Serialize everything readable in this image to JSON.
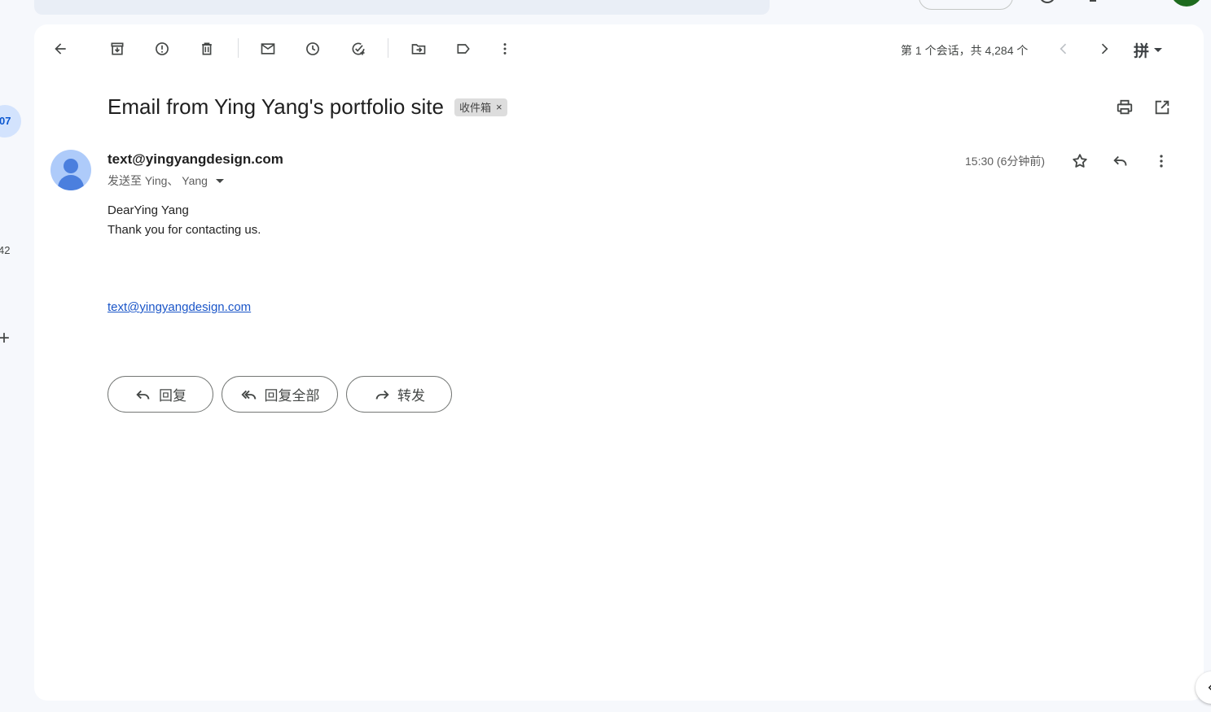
{
  "toolbar": {
    "back": "back-arrow-icon",
    "archive": "archive-icon",
    "report_spam": "report-spam-icon",
    "delete": "trash-icon",
    "mark_unread": "mail-icon",
    "snooze": "clock-icon",
    "add_task": "add-task-icon",
    "move_to": "move-to-folder-icon",
    "labels": "label-icon",
    "more": "more-vert-icon",
    "pager_text": "第 1 个会话，共 4,284 个",
    "ime_label": "拼"
  },
  "rail": {
    "badge": "07",
    "count": "42",
    "plus": "+"
  },
  "message": {
    "subject": "Email from Ying Yang's portfolio site",
    "label": "收件箱",
    "label_remove": "×",
    "sender": "text@yingyangdesign.com",
    "recipients": "发送至 Ying、 Yang",
    "time": "15:30 (6分钟前)",
    "body_lines": [
      "DearYing Yang",
      "Thank you for contacting us."
    ],
    "link": "text@yingyangdesign.com"
  },
  "actions": {
    "reply": "回复",
    "reply_all": "回复全部",
    "forward": "转发"
  },
  "colors": {
    "background": "#f6f8fc",
    "panel": "#ffffff",
    "link": "#1a55c8",
    "avatar_bg": "#aecbfa",
    "avatar_fg": "#4b7fde",
    "rail_badge": "#d3e3fd"
  }
}
